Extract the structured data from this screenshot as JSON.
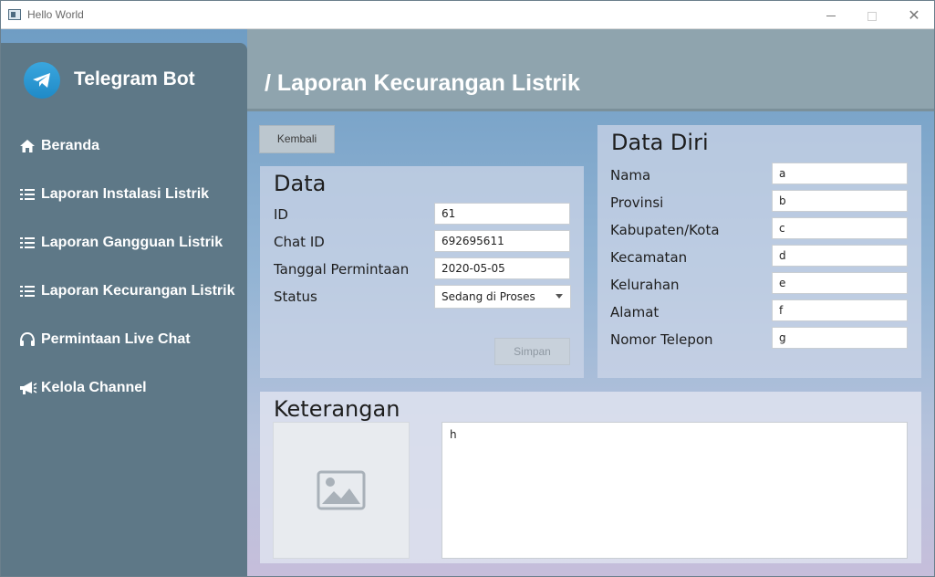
{
  "window": {
    "title": "Hello World"
  },
  "sidebar": {
    "brand": "Telegram Bot",
    "items": [
      {
        "label": "Beranda",
        "icon": "home-icon"
      },
      {
        "label": "Laporan Instalasi Listrik",
        "icon": "list-icon"
      },
      {
        "label": "Laporan Gangguan Listrik",
        "icon": "list-icon"
      },
      {
        "label": "Laporan Kecurangan Listrik",
        "icon": "list-icon"
      },
      {
        "label": "Permintaan Live Chat",
        "icon": "headset-icon"
      },
      {
        "label": "Kelola Channel",
        "icon": "megaphone-icon"
      }
    ]
  },
  "header": {
    "title": "/ Laporan Kecurangan Listrik"
  },
  "actions": {
    "back_label": "Kembali",
    "save_label": "Simpan"
  },
  "data_panel": {
    "title": "Data",
    "fields": [
      {
        "label": "ID",
        "value": "61"
      },
      {
        "label": "Chat ID",
        "value": "692695611"
      },
      {
        "label": "Tanggal Permintaan",
        "value": "2020-05-05"
      },
      {
        "label": "Status",
        "value": "Sedang di Proses"
      }
    ]
  },
  "data_diri": {
    "title": "Data Diri",
    "fields": [
      {
        "label": "Nama",
        "value": "a"
      },
      {
        "label": "Provinsi",
        "value": "b"
      },
      {
        "label": "Kabupaten/Kota",
        "value": "c"
      },
      {
        "label": "Kecamatan",
        "value": "d"
      },
      {
        "label": "Kelurahan",
        "value": "e"
      },
      {
        "label": "Alamat",
        "value": "f"
      },
      {
        "label": "Nomor Telepon",
        "value": "g"
      }
    ]
  },
  "keterangan": {
    "title": "Keterangan",
    "text": "h",
    "image_icon": "image-placeholder-icon"
  },
  "colors": {
    "sidebar": "#5e7887",
    "header": "#8fa4ae",
    "accent": "#2a9ad6"
  }
}
